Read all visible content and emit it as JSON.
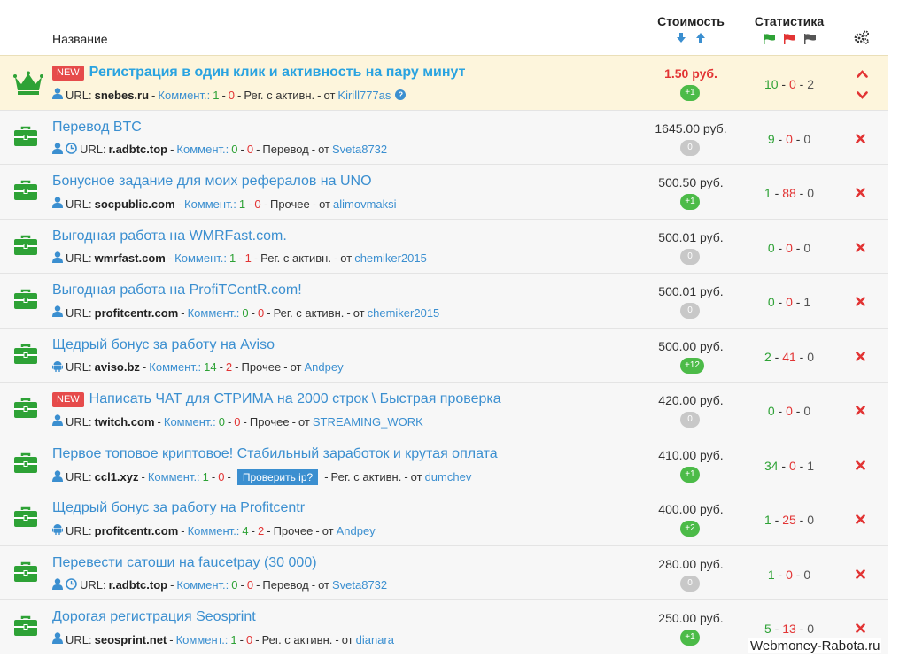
{
  "header": {
    "name_label": "Название",
    "cost_label": "Стоимость",
    "stat_label": "Статистика",
    "colors": {
      "accent": "#3b8fd0",
      "green": "#2ea236",
      "red": "#e23434"
    }
  },
  "tasks": [
    {
      "icon": "crown-icon",
      "new": "NEW",
      "title": "Регистрация в один клик и активность на пару минут",
      "url_label": "URL:",
      "url": "snebes.ru",
      "comm_label": "Коммент.:",
      "c_pos": "1",
      "c_neg": "0",
      "type": "Рег. с активн.",
      "from": "от",
      "author": "Kirill777as",
      "cost": "1.50 руб.",
      "bonus": "+1",
      "s_ok": "10",
      "s_bad": "0",
      "s_wait": "2"
    },
    {
      "icon": "briefcase-icon",
      "title": "Перевод BTC",
      "url_label": "URL:",
      "url": "r.adbtc.top",
      "comm_label": "Коммент.:",
      "c_pos": "0",
      "c_neg": "0",
      "type": "Перевод",
      "from": "от",
      "author": "Sveta8732",
      "cost": "1645.00 руб.",
      "bonus": "0",
      "s_ok": "9",
      "s_bad": "0",
      "s_wait": "0"
    },
    {
      "icon": "briefcase-icon",
      "title": "Бонусное задание для моих рефералов на UNO",
      "url_label": "URL:",
      "url": "socpublic.com",
      "comm_label": "Коммент.:",
      "c_pos": "1",
      "c_neg": "0",
      "type": "Прочее",
      "from": "от",
      "author": "alimovmaksi",
      "cost": "500.50 руб.",
      "bonus": "+1",
      "s_ok": "1",
      "s_bad": "88",
      "s_wait": "0"
    },
    {
      "icon": "briefcase-icon",
      "title": "Выгодная работа на WMRFast.com.",
      "url_label": "URL:",
      "url": "wmrfast.com",
      "comm_label": "Коммент.:",
      "c_pos": "1",
      "c_neg": "1",
      "type": "Рег. с активн.",
      "from": "от",
      "author": "chemiker2015",
      "cost": "500.01 руб.",
      "bonus": "0",
      "s_ok": "0",
      "s_bad": "0",
      "s_wait": "0"
    },
    {
      "icon": "briefcase-icon",
      "title": "Выгодная работа на ProfiTCentR.com!",
      "url_label": "URL:",
      "url": "profitcentr.com",
      "comm_label": "Коммент.:",
      "c_pos": "0",
      "c_neg": "0",
      "type": "Рег. с активн.",
      "from": "от",
      "author": "chemiker2015",
      "cost": "500.01 руб.",
      "bonus": "0",
      "s_ok": "0",
      "s_bad": "0",
      "s_wait": "1"
    },
    {
      "icon": "briefcase-icon",
      "title": "Щедрый бонус за работу на Aviso",
      "url_label": "URL:",
      "url": "aviso.bz",
      "comm_label": "Коммент.:",
      "c_pos": "14",
      "c_neg": "2",
      "type": "Прочее",
      "from": "от",
      "author": "Andpey",
      "cost": "500.00 руб.",
      "bonus": "+12",
      "s_ok": "2",
      "s_bad": "41",
      "s_wait": "0"
    },
    {
      "icon": "briefcase-icon",
      "new": "NEW",
      "title": "Написать ЧАТ для СТРИМА на 2000 строк \\ Быстрая проверка",
      "url_label": "URL:",
      "url": "twitch.com",
      "comm_label": "Коммент.:",
      "c_pos": "0",
      "c_neg": "0",
      "type": "Прочее",
      "from": "от",
      "author": "STREAMING_WORK",
      "cost": "420.00 руб.",
      "bonus": "0",
      "s_ok": "0",
      "s_bad": "0",
      "s_wait": "0"
    },
    {
      "icon": "briefcase-icon",
      "title": "Первое топовое криптовое! Стабильный заработок и крутая оплата",
      "url_label": "URL:",
      "url": "ccl1.xyz",
      "comm_label": "Коммент.:",
      "c_pos": "1",
      "c_neg": "0",
      "check_ip": "Проверить ip?",
      "type": "Рег. с активн.",
      "from": "от",
      "author": "dumchev",
      "cost": "410.00 руб.",
      "bonus": "+1",
      "s_ok": "34",
      "s_bad": "0",
      "s_wait": "1"
    },
    {
      "icon": "briefcase-icon",
      "title": "Щедрый бонус за работу на Profitcentr",
      "url_label": "URL:",
      "url": "profitcentr.com",
      "comm_label": "Коммент.:",
      "c_pos": "4",
      "c_neg": "2",
      "type": "Прочее",
      "from": "от",
      "author": "Andpey",
      "cost": "400.00 руб.",
      "bonus": "+2",
      "s_ok": "1",
      "s_bad": "25",
      "s_wait": "0"
    },
    {
      "icon": "briefcase-icon",
      "title": "Перевести сатоши на faucetpay (30 000)",
      "url_label": "URL:",
      "url": "r.adbtc.top",
      "comm_label": "Коммент.:",
      "c_pos": "0",
      "c_neg": "0",
      "type": "Перевод",
      "from": "от",
      "author": "Sveta8732",
      "cost": "280.00 руб.",
      "bonus": "0",
      "s_ok": "1",
      "s_bad": "0",
      "s_wait": "0"
    },
    {
      "icon": "briefcase-icon",
      "title": "Дорогая регистрация Seosprint",
      "url_label": "URL:",
      "url": "seosprint.net",
      "comm_label": "Коммент.:",
      "c_pos": "1",
      "c_neg": "0",
      "type": "Рег. с активн.",
      "from": "от",
      "author": "dianara",
      "cost": "250.00 руб.",
      "bonus": "+1",
      "s_ok": "5",
      "s_bad": "13",
      "s_wait": "0"
    }
  ],
  "row_icons": [
    "user-icon",
    "user-clock-icon",
    "user-icon",
    "user-icon",
    "user-icon",
    "android-icon",
    "user-icon",
    "user-icon",
    "android-icon",
    "user-clock-icon",
    "user-icon"
  ],
  "watermark": "Webmoney-Rabota.ru"
}
